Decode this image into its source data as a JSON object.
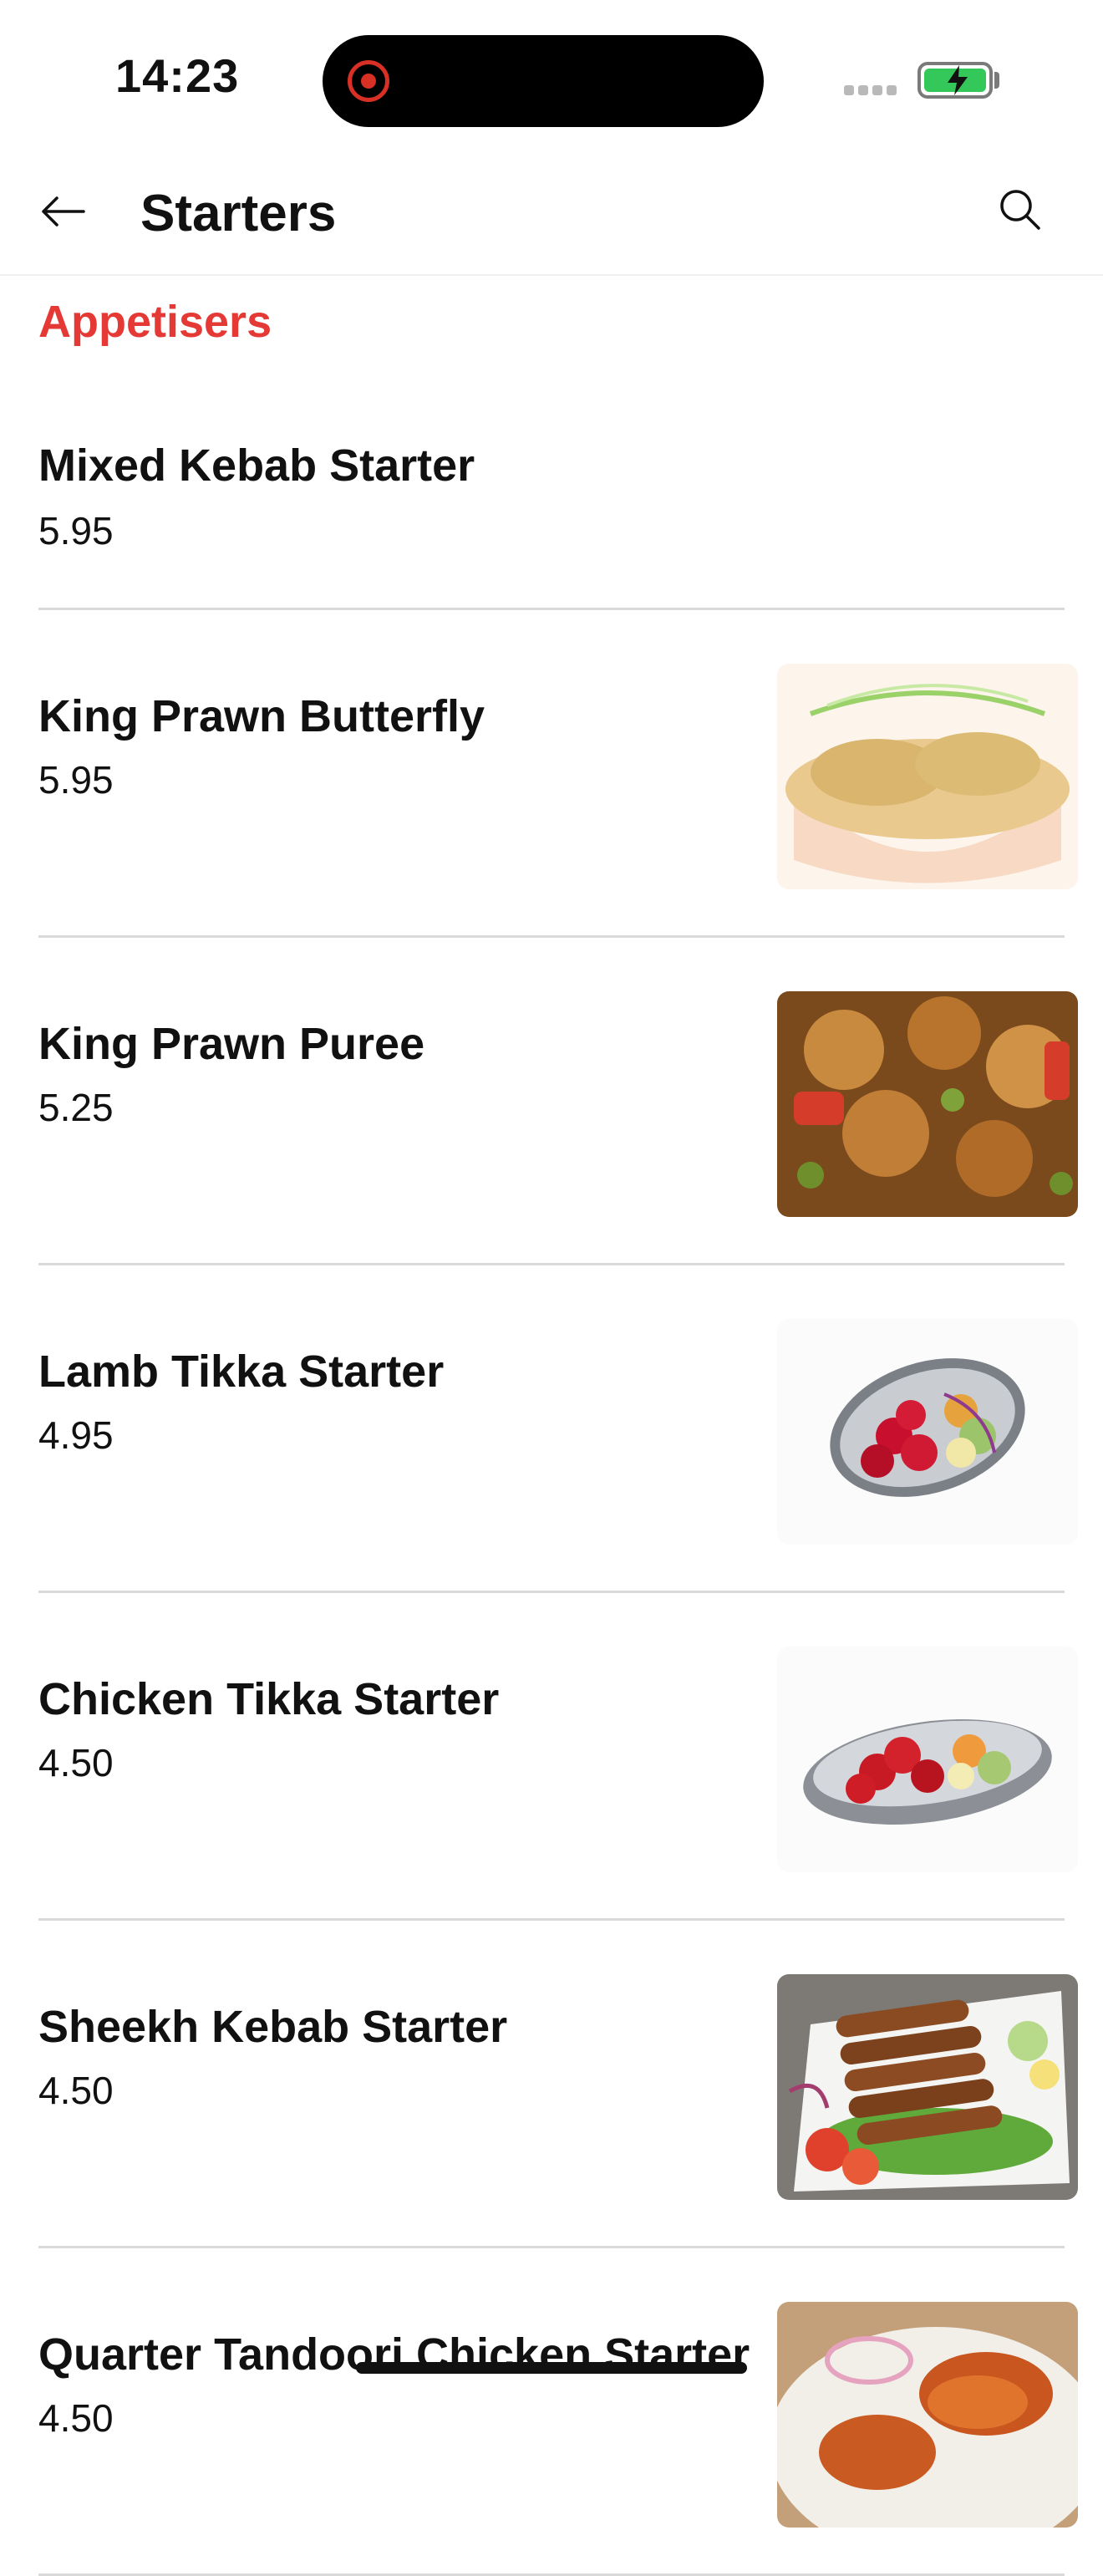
{
  "status_bar": {
    "time": "14:23"
  },
  "header": {
    "title": "Starters"
  },
  "section": {
    "title": "Appetisers"
  },
  "items": [
    {
      "name": "Mixed Kebab Starter",
      "price": "5.95"
    },
    {
      "name": "King Prawn Butterfly",
      "price": "5.95"
    },
    {
      "name": "King Prawn Puree",
      "price": "5.25"
    },
    {
      "name": "Lamb Tikka Starter",
      "price": "4.95"
    },
    {
      "name": "Chicken Tikka Starter",
      "price": "4.50"
    },
    {
      "name": "Sheekh Kebab Starter",
      "price": "4.50"
    },
    {
      "name": "Quarter Tandoori Chicken Starter",
      "price": "4.50"
    }
  ],
  "colors": {
    "accent": "#e53935",
    "battery": "#34c759"
  }
}
